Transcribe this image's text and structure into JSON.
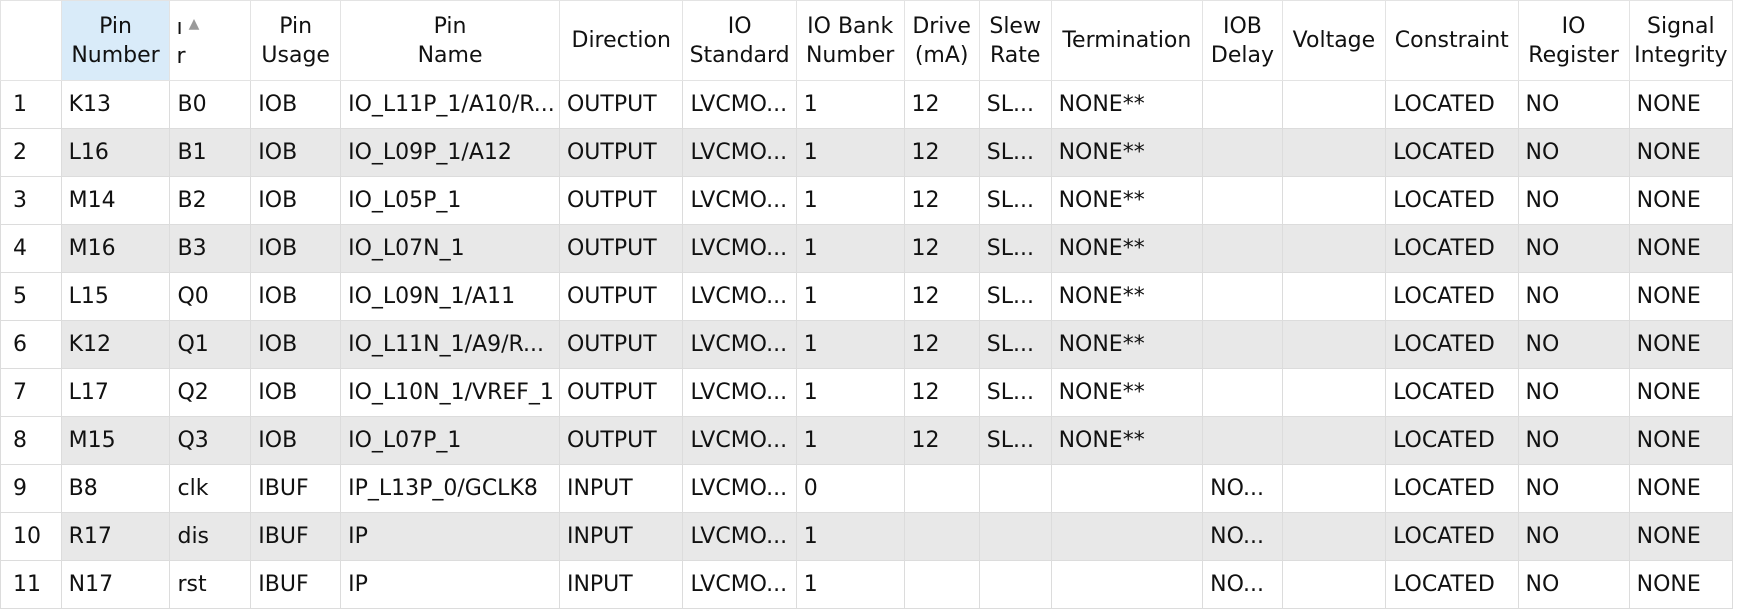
{
  "columns": [
    {
      "key": "rownum",
      "label": ""
    },
    {
      "key": "pin_number",
      "label": "Pin Number"
    },
    {
      "key": "pin_label",
      "label": "ı r"
    },
    {
      "key": "pin_usage",
      "label": "Pin Usage"
    },
    {
      "key": "pin_name",
      "label": "Pin Name"
    },
    {
      "key": "direction",
      "label": "Direction"
    },
    {
      "key": "io_standard",
      "label": "IO Standard"
    },
    {
      "key": "io_bank",
      "label": "IO Bank Number"
    },
    {
      "key": "drive",
      "label": "Drive (mA)"
    },
    {
      "key": "slew",
      "label": "Slew Rate"
    },
    {
      "key": "termination",
      "label": "Termination"
    },
    {
      "key": "iob_delay",
      "label": "IOB Delay"
    },
    {
      "key": "voltage",
      "label": "Voltage"
    },
    {
      "key": "constraint",
      "label": "Constraint"
    },
    {
      "key": "io_register",
      "label": "IO Register"
    },
    {
      "key": "signal_integrity",
      "label": "Signal Integrity"
    }
  ],
  "header": {
    "pin_number_l1": "Pin",
    "pin_number_l2": "Number",
    "pin_label_l1": "ı",
    "pin_label_l2": "r",
    "pin_usage_l1": "Pin",
    "pin_usage_l2": "Usage",
    "pin_name_l1": "Pin",
    "pin_name_l2": "Name",
    "direction": "Direction",
    "io_standard_l1": "IO",
    "io_standard_l2": "Standard",
    "io_bank_l1": "IO Bank",
    "io_bank_l2": "Number",
    "drive_l1": "Drive",
    "drive_l2": "(mA)",
    "slew_l1": "Slew",
    "slew_l2": "Rate",
    "termination": "Termination",
    "iob_delay_l1": "IOB",
    "iob_delay_l2": "Delay",
    "voltage": "Voltage",
    "constraint": "Constraint",
    "io_register_l1": "IO",
    "io_register_l2": "Register",
    "signal_integrity_l1": "Signal",
    "signal_integrity_l2": "Integrity",
    "sort_icon": "sort-ascending-icon"
  },
  "rows": [
    {
      "rownum": "1",
      "pin_number": "K13",
      "pin_label": "B0",
      "pin_usage": "IOB",
      "pin_name": "IO_L11P_1/A10/R...",
      "direction": "OUTPUT",
      "io_standard": "LVCMO...",
      "io_bank": "1",
      "drive": "12",
      "slew": "SL...",
      "termination": "NONE**",
      "iob_delay": "",
      "voltage": "",
      "constraint": "LOCATED",
      "io_register": "NO",
      "signal_integrity": "NONE"
    },
    {
      "rownum": "2",
      "pin_number": "L16",
      "pin_label": "B1",
      "pin_usage": "IOB",
      "pin_name": "IO_L09P_1/A12",
      "direction": "OUTPUT",
      "io_standard": "LVCMO...",
      "io_bank": "1",
      "drive": "12",
      "slew": "SL...",
      "termination": "NONE**",
      "iob_delay": "",
      "voltage": "",
      "constraint": "LOCATED",
      "io_register": "NO",
      "signal_integrity": "NONE"
    },
    {
      "rownum": "3",
      "pin_number": "M14",
      "pin_label": "B2",
      "pin_usage": "IOB",
      "pin_name": "IO_L05P_1",
      "direction": "OUTPUT",
      "io_standard": "LVCMO...",
      "io_bank": "1",
      "drive": "12",
      "slew": "SL...",
      "termination": "NONE**",
      "iob_delay": "",
      "voltage": "",
      "constraint": "LOCATED",
      "io_register": "NO",
      "signal_integrity": "NONE"
    },
    {
      "rownum": "4",
      "pin_number": "M16",
      "pin_label": "B3",
      "pin_usage": "IOB",
      "pin_name": "IO_L07N_1",
      "direction": "OUTPUT",
      "io_standard": "LVCMO...",
      "io_bank": "1",
      "drive": "12",
      "slew": "SL...",
      "termination": "NONE**",
      "iob_delay": "",
      "voltage": "",
      "constraint": "LOCATED",
      "io_register": "NO",
      "signal_integrity": "NONE"
    },
    {
      "rownum": "5",
      "pin_number": "L15",
      "pin_label": "Q0",
      "pin_usage": "IOB",
      "pin_name": "IO_L09N_1/A11",
      "direction": "OUTPUT",
      "io_standard": "LVCMO...",
      "io_bank": "1",
      "drive": "12",
      "slew": "SL...",
      "termination": "NONE**",
      "iob_delay": "",
      "voltage": "",
      "constraint": "LOCATED",
      "io_register": "NO",
      "signal_integrity": "NONE"
    },
    {
      "rownum": "6",
      "pin_number": "K12",
      "pin_label": "Q1",
      "pin_usage": "IOB",
      "pin_name": "IO_L11N_1/A9/R...",
      "direction": "OUTPUT",
      "io_standard": "LVCMO...",
      "io_bank": "1",
      "drive": "12",
      "slew": "SL...",
      "termination": "NONE**",
      "iob_delay": "",
      "voltage": "",
      "constraint": "LOCATED",
      "io_register": "NO",
      "signal_integrity": "NONE"
    },
    {
      "rownum": "7",
      "pin_number": "L17",
      "pin_label": "Q2",
      "pin_usage": "IOB",
      "pin_name": "IO_L10N_1/VREF_1",
      "direction": "OUTPUT",
      "io_standard": "LVCMO...",
      "io_bank": "1",
      "drive": "12",
      "slew": "SL...",
      "termination": "NONE**",
      "iob_delay": "",
      "voltage": "",
      "constraint": "LOCATED",
      "io_register": "NO",
      "signal_integrity": "NONE"
    },
    {
      "rownum": "8",
      "pin_number": "M15",
      "pin_label": "Q3",
      "pin_usage": "IOB",
      "pin_name": "IO_L07P_1",
      "direction": "OUTPUT",
      "io_standard": "LVCMO...",
      "io_bank": "1",
      "drive": "12",
      "slew": "SL...",
      "termination": "NONE**",
      "iob_delay": "",
      "voltage": "",
      "constraint": "LOCATED",
      "io_register": "NO",
      "signal_integrity": "NONE"
    },
    {
      "rownum": "9",
      "pin_number": "B8",
      "pin_label": "clk",
      "pin_usage": "IBUF",
      "pin_name": "IP_L13P_0/GCLK8",
      "direction": "INPUT",
      "io_standard": "LVCMO...",
      "io_bank": "0",
      "drive": "",
      "slew": "",
      "termination": "",
      "iob_delay": "NO...",
      "voltage": "",
      "constraint": "LOCATED",
      "io_register": "NO",
      "signal_integrity": "NONE"
    },
    {
      "rownum": "10",
      "pin_number": "R17",
      "pin_label": "dis",
      "pin_usage": "IBUF",
      "pin_name": "IP",
      "direction": "INPUT",
      "io_standard": "LVCMO...",
      "io_bank": "1",
      "drive": "",
      "slew": "",
      "termination": "",
      "iob_delay": "NO...",
      "voltage": "",
      "constraint": "LOCATED",
      "io_register": "NO",
      "signal_integrity": "NONE"
    },
    {
      "rownum": "11",
      "pin_number": "N17",
      "pin_label": "rst",
      "pin_usage": "IBUF",
      "pin_name": "IP",
      "direction": "INPUT",
      "io_standard": "LVCMO...",
      "io_bank": "1",
      "drive": "",
      "slew": "",
      "termination": "",
      "iob_delay": "NO...",
      "voltage": "",
      "constraint": "LOCATED",
      "io_register": "NO",
      "signal_integrity": "NONE"
    }
  ]
}
